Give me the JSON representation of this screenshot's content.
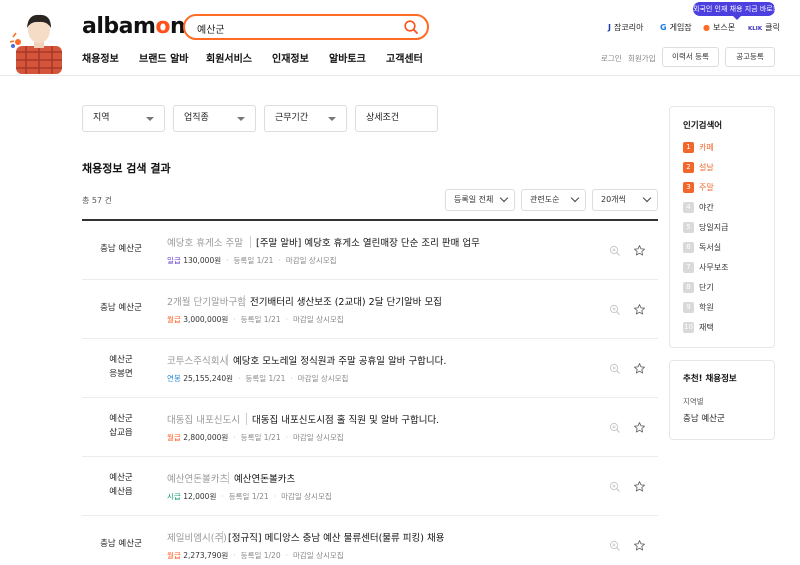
{
  "header": {
    "logo": {
      "a": "alba",
      "b": "m",
      "c": "o",
      "d": "n"
    },
    "search_value": "예산군",
    "promo": "외국인 인재 채용 지금 바로!",
    "family_links": [
      {
        "icon": "J",
        "label": "잡코리아"
      },
      {
        "icon": "G",
        "label": "게임잡"
      },
      {
        "icon": "●",
        "label": "보스몬"
      },
      {
        "icon": "KLIK",
        "label": "클릭"
      }
    ],
    "gnb": [
      "채용정보",
      "브랜드 알바",
      "회원서비스",
      "인재정보",
      "알바토크",
      "고객센터"
    ],
    "login": "로그인",
    "signup": "회원가입",
    "resume_button": "이력서 등록",
    "post_button": "공고등록"
  },
  "filters": [
    "지역",
    "업직종",
    "근무기간",
    "상세조건"
  ],
  "results": {
    "title": "채용정보 검색 결과",
    "total": "총 57 건",
    "sort": [
      "등록일 전체",
      "관련도순",
      "20개씩"
    ]
  },
  "jobs": [
    {
      "loc1": "충남 예산군",
      "loc2": "",
      "company": "예당호 휴게소 주말",
      "title": "[주말 알바] 예당호 휴게소 열린매장 단순 조리 판매 업무",
      "pay_type": "일급",
      "pay_color": "#6a3fd6",
      "pay": "130,000원",
      "reg": "등록일 1/21",
      "deadline": "마감일 상시모집"
    },
    {
      "loc1": "충남 예산군",
      "loc2": "",
      "company": "2개월 단기알바구함",
      "title": "전기배터리 생산보조 (2교대) 2달 단기알바 모집",
      "pay_type": "월급",
      "pay_color": "#ff5a1f",
      "pay": "3,000,000원",
      "reg": "등록일 1/21",
      "deadline": "마감일 상시모집"
    },
    {
      "loc1": "예산군",
      "loc2": "응봉면",
      "company": "코투스주식회사",
      "title": "예당호 모노레일 정식원과 주말 공휴일 알바 구합니다.",
      "pay_type": "연봉",
      "pay_color": "#2a8bd8",
      "pay": "25,155,240원",
      "reg": "등록일 1/21",
      "deadline": "마감일 상시모집"
    },
    {
      "loc1": "예산군",
      "loc2": "삽교읍",
      "company": "대동집 내포신도시",
      "title": "대동집 내포신도시점 홀 직원 및 알바 구합니다.",
      "pay_type": "월급",
      "pay_color": "#ff5a1f",
      "pay": "2,800,000원",
      "reg": "등록일 1/21",
      "deadline": "마감일 상시모집"
    },
    {
      "loc1": "예산군",
      "loc2": "예산읍",
      "company": "예산연돈볼카츠",
      "title": "예산연돈볼카츠",
      "pay_type": "시급",
      "pay_color": "#1aa36b",
      "pay": "12,000원",
      "reg": "등록일 1/21",
      "deadline": "마감일 상시모집"
    },
    {
      "loc1": "충남 예산군",
      "loc2": "",
      "company": "제일비엠시(주)",
      "title": "[정규직] 메디앙스 충남 예산 물류센터(물류 피킹) 채용",
      "pay_type": "월급",
      "pay_color": "#ff5a1f",
      "pay": "2,273,790원",
      "reg": "등록일 1/20",
      "deadline": "마감일 상시모집"
    }
  ],
  "sidebar": {
    "popular_title": "인기검색어",
    "keywords": [
      {
        "n": "1",
        "label": "카페",
        "hot": true
      },
      {
        "n": "2",
        "label": "설날",
        "hot": true
      },
      {
        "n": "3",
        "label": "주말",
        "hot": true
      },
      {
        "n": "4",
        "label": "야간",
        "hot": false
      },
      {
        "n": "5",
        "label": "당일지급",
        "hot": false
      },
      {
        "n": "6",
        "label": "독서실",
        "hot": false
      },
      {
        "n": "7",
        "label": "사무보조",
        "hot": false
      },
      {
        "n": "8",
        "label": "단기",
        "hot": false
      },
      {
        "n": "9",
        "label": "학원",
        "hot": false
      },
      {
        "n": "10",
        "label": "재택",
        "hot": false
      }
    ],
    "recommend_title": "추천! 채용정보",
    "recommend_label": "지역별",
    "recommend_value": "충남 예산군"
  },
  "colors": {
    "brand": "#ff501b",
    "hot": "#f2662a",
    "cold": "#d9d9d9"
  }
}
